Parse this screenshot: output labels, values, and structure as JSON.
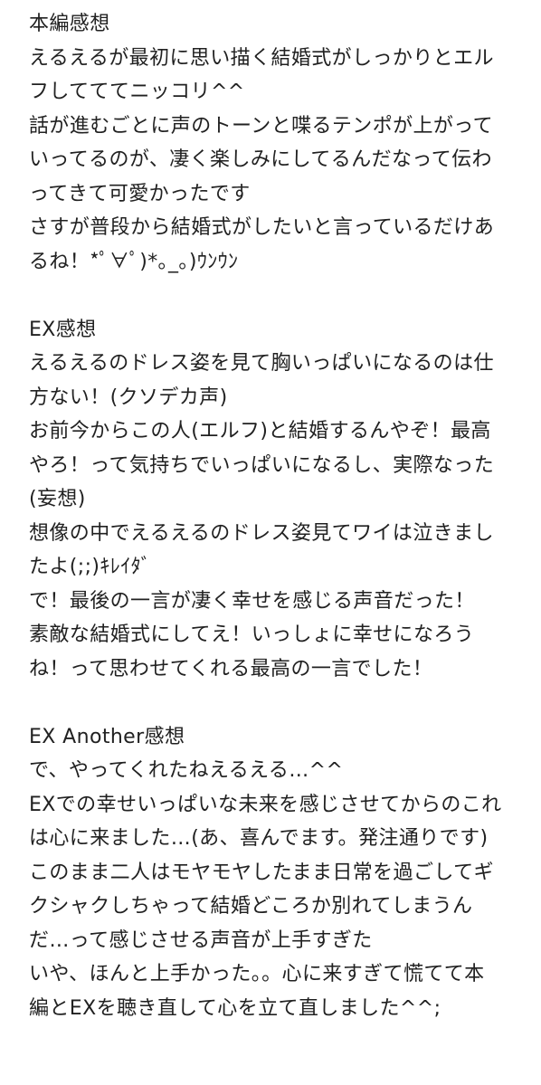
{
  "sections": [
    {
      "heading": "本編感想",
      "lines": [
        "えるえるが最初に思い描く結婚式がしっかりとエル",
        "フしてててニッコリ^^",
        "話が進むごとに声のトーンと喋るテンポが上がって",
        "いってるのが、凄く楽しみにしてるんだなって伝わ",
        "ってきて可愛かったです",
        "さすが普段から結婚式がしたいと言っているだけあ",
        "るね！*ﾟ∀ﾟ)*｡_｡)ｳﾝｳﾝ"
      ]
    },
    {
      "heading": "EX感想",
      "lines": [
        "えるえるのドレス姿を見て胸いっぱいになるのは仕",
        "方ない！(クソデカ声)",
        "お前今からこの人(エルフ)と結婚するんやぞ！最高",
        "やろ！って気持ちでいっぱいになるし、実際なった",
        "(妄想)",
        "想像の中でえるえるのドレス姿見てワイは泣きまし",
        "たよ(;;)ｷﾚｲﾀﾞ",
        "で！最後の一言が凄く幸せを感じる声音だった！",
        "素敵な結婚式にしてえ！いっしょに幸せになろう",
        "ね！って思わせてくれる最高の一言でした！"
      ]
    },
    {
      "heading": "EX Another感想",
      "lines": [
        "で、やってくれたねえるえる…^^",
        "EXでの幸せいっぱいな未来を感じさせてからのこれ",
        "は心に来ました…(あ、喜んでます。発注通りです)",
        "このまま二人はモヤモヤしたまま日常を過ごしてギ",
        "クシャクしちゃって結婚どころか別れてしまうん",
        "だ…って感じさせる声音が上手すぎた",
        "いや、ほんと上手かった。。心に来すぎて慌てて本",
        "編とEXを聴き直して心を立て直しました^^;"
      ]
    }
  ]
}
